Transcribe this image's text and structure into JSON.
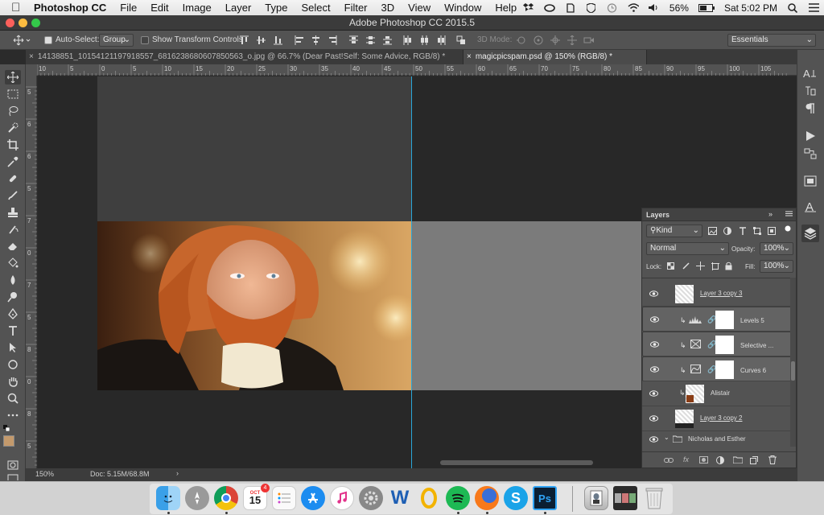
{
  "menubar": {
    "app_name": "Photoshop CC",
    "items": [
      "File",
      "Edit",
      "Image",
      "Layer",
      "Type",
      "Select",
      "Filter",
      "3D",
      "View",
      "Window",
      "Help"
    ],
    "battery": "56%",
    "clock": "Sat 5:02 PM"
  },
  "window": {
    "title": "Adobe Photoshop CC 2015.5"
  },
  "options": {
    "auto_select_label": "Auto-Select:",
    "auto_select_value": "Group",
    "show_transform_label": "Show Transform Controls",
    "mode_3d_label": "3D Mode:",
    "workspace_value": "Essentials"
  },
  "tabs": [
    {
      "label": "14138851_10154121197918557_6816238680607850563_o.jpg @ 66.7% (Dear  Past!Self:  Some  Advice, RGB/8) *",
      "active": false
    },
    {
      "label": "magicpicspam.psd @ 150% (RGB/8) *",
      "active": true
    }
  ],
  "ruler": {
    "h_labels": [
      "10",
      "5",
      "0",
      "5",
      "10",
      "15",
      "20",
      "25",
      "30",
      "35",
      "40",
      "45",
      "50",
      "55",
      "60",
      "65",
      "70",
      "75",
      "80",
      "85",
      "90",
      "95",
      "100",
      "105"
    ],
    "v_labels": [
      "5",
      "6",
      "6",
      "5",
      "7",
      "0",
      "7",
      "5",
      "8",
      "0",
      "8",
      "5"
    ]
  },
  "statusbar": {
    "zoom": "150%",
    "doc": "Doc: 5.15M/68.8M"
  },
  "layers_panel": {
    "title": "Layers",
    "filter_kind": "Kind",
    "blend_mode": "Normal",
    "opacity_label": "Opacity:",
    "opacity_value": "100%",
    "lock_label": "Lock:",
    "fill_label": "Fill:",
    "fill_value": "100%",
    "layers": [
      {
        "name": "Layer 3 copy 3",
        "type": "pixel"
      },
      {
        "name": "Levels 5",
        "type": "adjustment",
        "icon": "levels-icon",
        "selected": true
      },
      {
        "name": "Selective ...",
        "type": "adjustment",
        "icon": "selective-color-icon",
        "selected": true
      },
      {
        "name": "Curves 6",
        "type": "adjustment",
        "icon": "curves-icon",
        "selected": true
      },
      {
        "name": "Alistair",
        "type": "clipped-pixel"
      },
      {
        "name": "Layer 3 copy 2",
        "type": "pixel"
      },
      {
        "name": "Nicholas and Esther",
        "type": "group"
      }
    ]
  },
  "dock": {
    "calendar_month": "OCT",
    "calendar_day": "15",
    "calendar_badge": "4",
    "apps": [
      "finder-icon",
      "launchpad-icon",
      "chrome-icon",
      "calendar-icon",
      "reminders-icon",
      "app-store-icon",
      "itunes-icon",
      "system-preferences-icon",
      "word-icon",
      "outlook-icon",
      "spotify-icon",
      "firefox-icon",
      "skype-icon",
      "photoshop-icon",
      "preview-icon",
      "photos-stack-icon",
      "trash-icon"
    ],
    "word_letter": "W",
    "skype_letter": "S",
    "photoshop_letters": "Ps"
  },
  "colors": {
    "accent_blue": "#2a8dd4",
    "foreground_swatch": "#c49a6c",
    "background_swatch": "#ffffff"
  }
}
